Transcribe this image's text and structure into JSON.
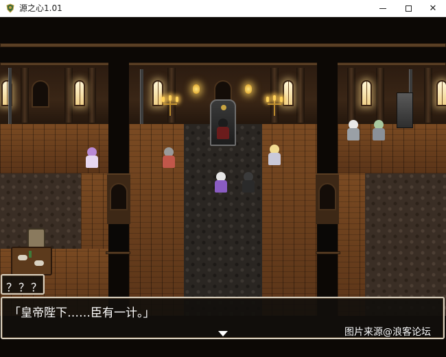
{
  "window": {
    "title": "源之心1.01",
    "icon": "game-shield-icon",
    "minimize_icon": "minimize-icon",
    "maximize_icon": "maximize-icon",
    "close_icon": "close-icon",
    "close_glyph": "✕"
  },
  "dialog": {
    "speaker": "？？？",
    "message": "「皇帝陛下……臣有一计。」",
    "advance_icon": "advance-arrow-icon"
  },
  "overlay": {
    "watermark": "图片来源@浪客论坛"
  },
  "colors": {
    "dialog_border": "#d9d0bf",
    "dialog_bg": "#120f0c",
    "text": "#ffffff",
    "wood_floor": "#6b3e1c",
    "lamp_glow": "#ffd35a"
  }
}
